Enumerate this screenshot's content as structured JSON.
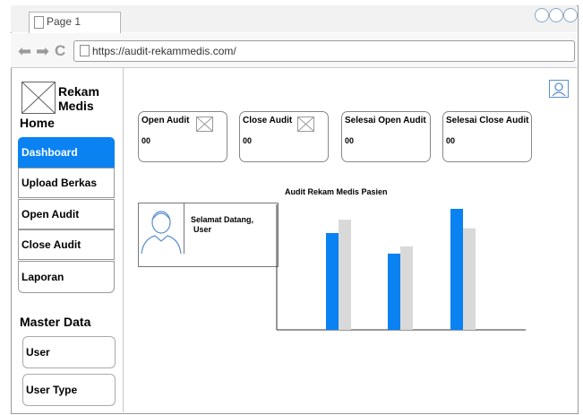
{
  "browser": {
    "tab_title": "Page 1",
    "url": "https://audit-rekammedis.com/"
  },
  "sidebar": {
    "logo_text": "Rekam Medis",
    "home_heading": "Home",
    "items": [
      {
        "label": "Dashboard",
        "active": true
      },
      {
        "label": "Upload Berkas",
        "active": false
      },
      {
        "label": "Open Audit",
        "active": false
      },
      {
        "label": "Close Audit",
        "active": false
      },
      {
        "label": "Laporan",
        "active": false
      }
    ],
    "master_heading": "Master Data",
    "master_items": [
      {
        "label": "User"
      },
      {
        "label": "User Type"
      }
    ]
  },
  "cards": [
    {
      "title": "Open Audit",
      "value": "00"
    },
    {
      "title": "Close Audit",
      "value": "00"
    },
    {
      "title": "Selesai Open Audit",
      "value": "00"
    },
    {
      "title": "Selesai Close Audit",
      "value": "00"
    }
  ],
  "welcome": {
    "line1": "Selamat Datang,",
    "line2": "User"
  },
  "chart_data": {
    "type": "bar",
    "title": "Audit Rekam Medis Pasien",
    "categories": [
      "",
      "",
      ""
    ],
    "series": [
      {
        "color": "#0a82f2",
        "values": [
          80,
          63,
          100
        ]
      },
      {
        "color": "#d9d9d9",
        "values": [
          91,
          69,
          84
        ]
      }
    ],
    "ylim": [
      0,
      100
    ],
    "grid": false,
    "colors": {
      "primary": "#0a82f2",
      "secondary": "#d9d9d9"
    }
  },
  "colors": {
    "accent": "#0a82f2"
  }
}
